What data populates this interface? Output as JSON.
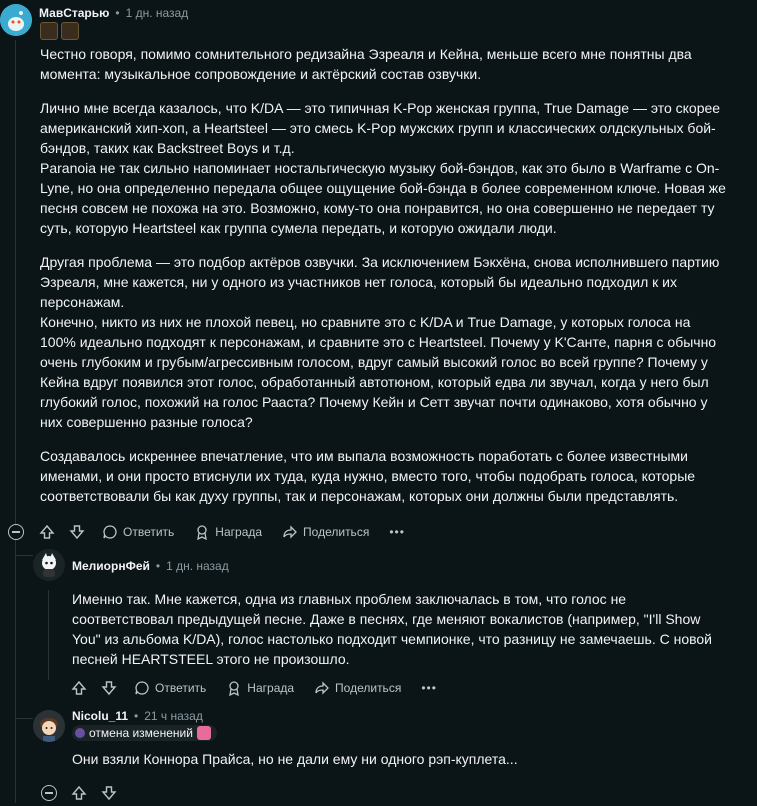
{
  "comment1": {
    "author": "МавСтарью",
    "separator": "•",
    "time": "1 дн. назад",
    "paragraphs": [
      "Честно говоря, помимо сомнительного редизайна Эзреаля и Кейна, меньше всего мне понятны два\nмомента: музыкальное сопровождение и актёрский состав озвучки.",
      "Лично мне всегда казалось, что K/DA — это типичная K-Pop женская группа, True Damage — это скорее\nамериканский хип-хоп, а Heartsteel — это смесь K-Pop мужских групп и классических олдскульных бой-\nбэндов, таких как Backstreet Boys и т.д.\nParanoia не так сильно напоминает ностальгическую музыку бой-бэндов, как это было в Warframe с On-\nLyne, но она определенно передала общее ощущение бой-бэнда в более современном ключе. Новая же\nпесня совсем не похожа на это. Возможно, кому-то она понравится, но она совершенно не передает ту\nсуть, которую Heartsteel как группа сумела передать, и которую ожидали люди.",
      "Другая проблема — это подбор актёров озвучки. За исключением Бэкхёна, снова исполнившего партию\nЭзреаля, мне кажется, ни у одного из участников нет голоса, который бы идеально подходил к их\nперсонажам.\nКонечно, никто из них не плохой певец, но сравните это с K/DA и True Damage, у которых голоса на\n100% идеально подходят к персонажам, и сравните это с Heartsteel. Почему у K'Санте, парня с обычно\nочень глубоким и грубым/агрессивным голосом, вдруг самый высокий голос во всей группе? Почему у\nКейна вдруг появился этот голос, обработанный автотюном, который едва ли звучал, когда у него был\nглубокий голос, похожий на голос Рааста? Почему Кейн и Сетт звучат почти одинаково, хотя обычно у\nних совершенно разные голоса?",
      "Создавалось искреннее впечатление, что им выпала возможность поработать с более известными\nименами, и они просто втиснули их туда, куда нужно, вместо того, чтобы подобрать голоса, которые\nсоответствовали бы как духу группы, так и персонажам, которых они должны были представлять."
    ]
  },
  "comment2": {
    "author": "МелиорнФей",
    "separator": "•",
    "time": "1 дн. назад",
    "paragraphs": [
      "Именно так. Мне кажется, одна из главных проблем заключалась в том, что голос не\nсоответствовал предыдущей песне. Даже в песнях, где меняют вокалистов (например, \"I'll Show\nYou\" из альбома K/DA), голос настолько подходит чемпионке, что разницу не замечаешь. С новой\nпесней HEARTSTEEL этого не произошло."
    ]
  },
  "comment3": {
    "author": "Nicolu_11",
    "separator": "•",
    "time": "21 ч назад",
    "flair": "отмена изменений",
    "paragraphs": [
      "Они взяли Коннора Прайса, но не дали ему ни одного рэп-куплета..."
    ]
  },
  "actions": {
    "reply": "Ответить",
    "award": "Награда",
    "share": "Поделиться",
    "more": "•••"
  },
  "colors": {
    "background": "#0b1416",
    "text": "#f2f4f5",
    "muted": "#8b9ca3",
    "thread_line": "#2a3236"
  }
}
